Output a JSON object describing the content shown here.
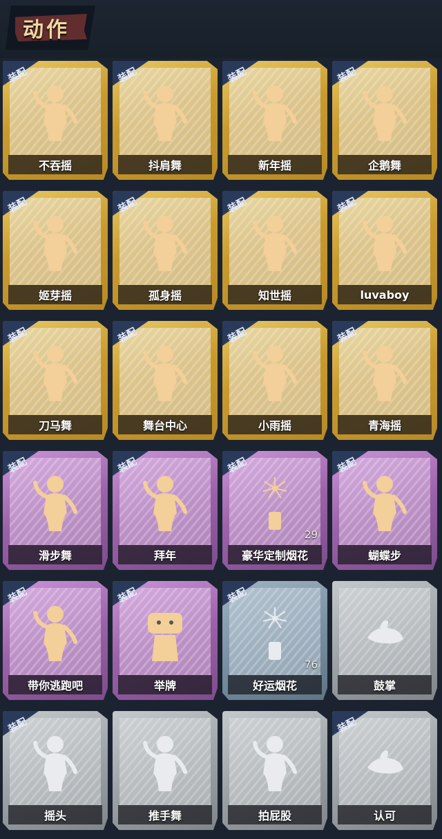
{
  "header": {
    "title": "动作"
  },
  "cards": [
    {
      "label": "不吞摇",
      "tier": "gold",
      "equipped": true,
      "icon": "dancer-figure-icon"
    },
    {
      "label": "抖肩舞",
      "tier": "gold",
      "equipped": true,
      "icon": "dancer-figure-icon"
    },
    {
      "label": "新年摇",
      "tier": "gold",
      "equipped": true,
      "icon": "dancer-figure-icon"
    },
    {
      "label": "企鹅舞",
      "tier": "gold",
      "equipped": true,
      "icon": "dancer-figure-icon"
    },
    {
      "label": "姬芽摇",
      "tier": "gold",
      "equipped": true,
      "icon": "dancer-figure-icon"
    },
    {
      "label": "孤身摇",
      "tier": "gold",
      "equipped": true,
      "icon": "dancer-figure-icon"
    },
    {
      "label": "知世摇",
      "tier": "gold",
      "equipped": true,
      "icon": "dancer-figure-icon"
    },
    {
      "label": "luvaboy",
      "tier": "gold",
      "equipped": true,
      "icon": "dancer-figure-icon"
    },
    {
      "label": "刀马舞",
      "tier": "gold",
      "equipped": true,
      "icon": "dancer-figure-icon"
    },
    {
      "label": "舞台中心",
      "tier": "gold",
      "equipped": true,
      "icon": "dancer-figure-icon"
    },
    {
      "label": "小雨摇",
      "tier": "gold",
      "equipped": true,
      "icon": "dancer-figure-icon"
    },
    {
      "label": "青海摇",
      "tier": "gold",
      "equipped": true,
      "icon": "dancer-figure-icon"
    },
    {
      "label": "滑步舞",
      "tier": "purple",
      "equipped": true,
      "icon": "dancer-figure-icon"
    },
    {
      "label": "拜年",
      "tier": "purple",
      "equipped": true,
      "icon": "bow-figure-icon"
    },
    {
      "label": "豪华定制烟花",
      "tier": "purple",
      "equipped": true,
      "icon": "fireworks-icon",
      "count": "29"
    },
    {
      "label": "蝴蝶步",
      "tier": "purple",
      "equipped": true,
      "icon": "dancer-figure-icon"
    },
    {
      "label": "带你逃跑吧",
      "tier": "purple",
      "equipped": true,
      "icon": "dancer-figure-icon"
    },
    {
      "label": "举牌",
      "tier": "purple",
      "equipped": true,
      "icon": "sign-holding-icon"
    },
    {
      "label": "好运烟花",
      "tier": "blue",
      "equipped": true,
      "icon": "firework-cylinder-icon",
      "count": "76"
    },
    {
      "label": "鼓掌",
      "tier": "gray",
      "equipped": false,
      "icon": "clapping-hands-icon"
    },
    {
      "label": "摇头",
      "tier": "gray",
      "equipped": true,
      "icon": "dancer-figure-icon"
    },
    {
      "label": "推手舞",
      "tier": "gray",
      "equipped": false,
      "icon": "dancer-figure-icon"
    },
    {
      "label": "拍屁股",
      "tier": "gray",
      "equipped": false,
      "icon": "dancer-figure-icon"
    },
    {
      "label": "认可",
      "tier": "gray",
      "equipped": true,
      "icon": "thumbs-up-icon"
    }
  ],
  "tag_text": "装配",
  "colors": {
    "gold": "#d4a73f",
    "purple": "#a46db2",
    "blue": "#7f96a8",
    "gray": "#a3a8ac"
  }
}
